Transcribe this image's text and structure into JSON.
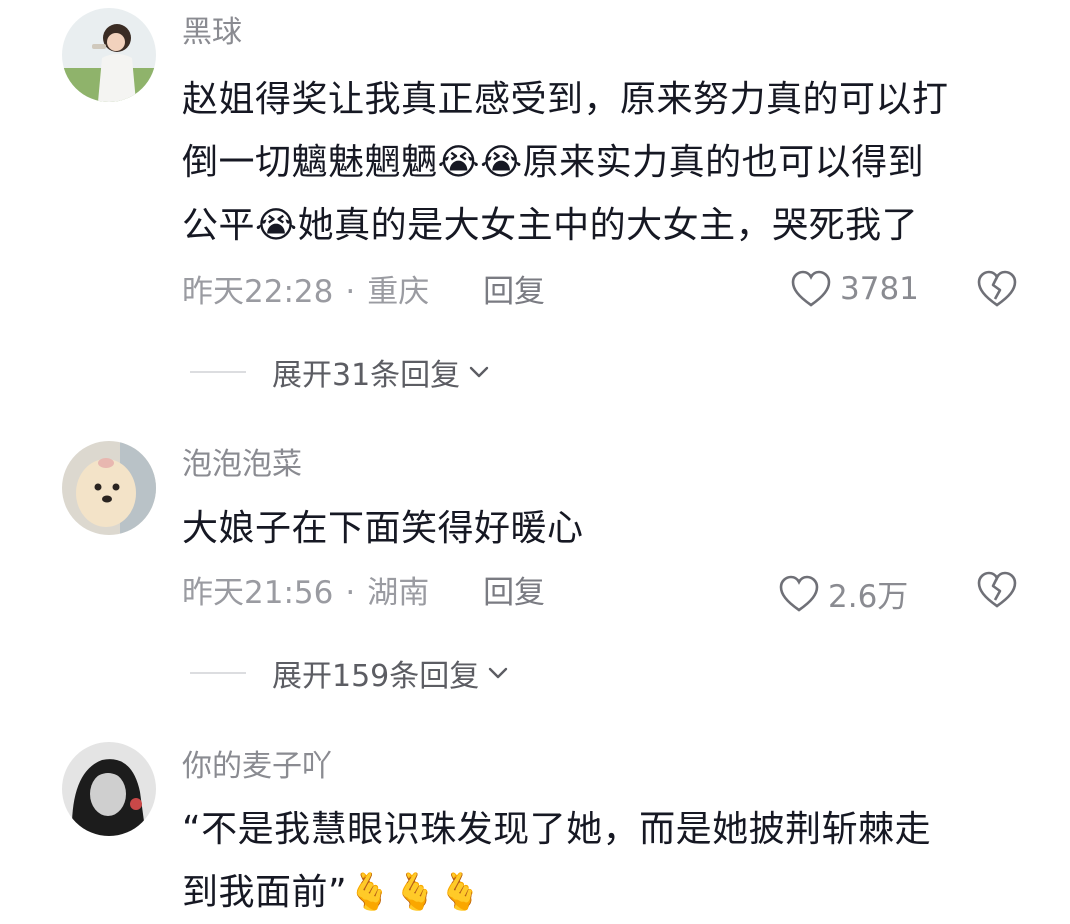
{
  "comments": [
    {
      "username": "黑球",
      "lines": [
        "赵姐得奖让我真正感受到，原来努力真的可以打",
        "倒一切魑魅魍魉😭😭原来实力真的也可以得到",
        "公平😭她真的是大女主中的大女主，哭死我了"
      ],
      "time": "昨天22:28",
      "location": "重庆",
      "reply_label": "回复",
      "likes": "3781",
      "expand_label": "展开31条回复"
    },
    {
      "username": "泡泡泡菜",
      "lines": [
        "大娘子在下面笑得好暖心"
      ],
      "time": "昨天21:56",
      "location": "湖南",
      "reply_label": "回复",
      "likes": "2.6万",
      "expand_label": "展开159条回复"
    },
    {
      "username": "你的麦子吖",
      "lines": [
        "“不是我慧眼识珠发现了她，而是她披荆斩棘走",
        "到我面前”🫰🫰🫰"
      ]
    }
  ],
  "separator": "·",
  "icons": {
    "like": "heart-outline-icon",
    "dislike": "broken-heart-icon",
    "expand": "chevron-down-icon"
  },
  "colors": {
    "text": "#161823",
    "secondary": "#8a8b91"
  }
}
